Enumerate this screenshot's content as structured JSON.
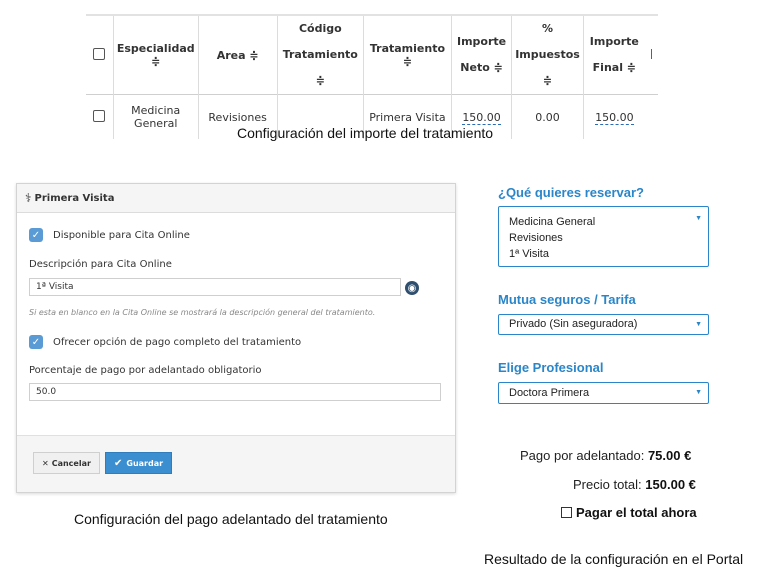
{
  "table": {
    "headers": {
      "especialidad": "Especialidad ≑",
      "area": "Area ≑",
      "codigo_1": "Código",
      "codigo_2": "Tratamiento ≑",
      "tratamiento": "Tratamiento ≑",
      "neto_1": "Importe",
      "neto_2": "Neto ≑",
      "impuestos_1": "%",
      "impuestos_2": "Impuestos ≑",
      "final_1": "Importe",
      "final_2": "Final ≑"
    },
    "row": {
      "especialidad_1": "Medicina",
      "especialidad_2": "General",
      "area": "Revisiones",
      "codigo": "",
      "tratamiento": "Primera Visita",
      "neto": "150.00",
      "impuestos": "0.00",
      "final": "150.00"
    },
    "caption": "Configuración del importe del tratamiento"
  },
  "dialog": {
    "title": "Primera Visita",
    "disponible_label": "Disponible para Cita Online",
    "descripcion_label": "Descripción para Cita Online",
    "descripcion_value": "1ª Visita",
    "hint": "Si esta en blanco en la Cita Online se mostrará la descripción general del tratamiento.",
    "ofrecer_label": "Ofrecer opción de pago completo del tratamiento",
    "porcentaje_label": "Porcentaje de pago por adelantado obligatorio",
    "porcentaje_value": "50.0",
    "cancel_label": "Cancelar",
    "save_label": "Guardar",
    "caption": "Configuración del pago adelantado del tratamiento"
  },
  "portal": {
    "reservar_title": "¿Qué quieres reservar?",
    "reservar_lines": [
      "Medicina General",
      "Revisiones",
      "1ª Visita"
    ],
    "mutua_title": "Mutua seguros / Tarifa",
    "mutua_value": "Privado (Sin aseguradora)",
    "profesional_title": "Elige Profesional",
    "profesional_value": "Doctora Primera",
    "adelantado_label": "Pago por adelantado:",
    "adelantado_value": "75.00 €",
    "total_label": "Precio total:",
    "total_value": "150.00 €",
    "pagar_label": "Pagar el total ahora",
    "caption": "Resultado de la configuración en el Portal",
    "accent": "#2a86c8"
  }
}
